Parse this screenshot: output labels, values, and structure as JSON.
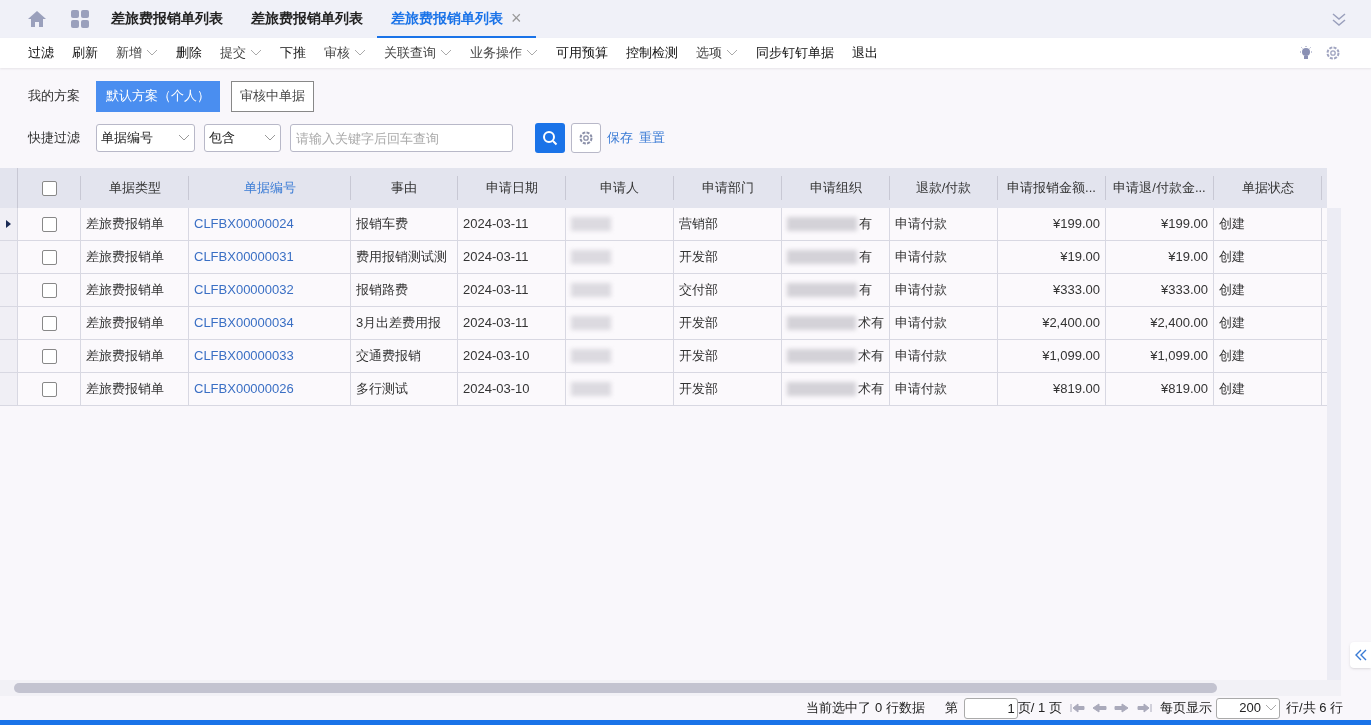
{
  "tabs": [
    {
      "label": "差旅费报销单列表",
      "selected": false,
      "closable": false
    },
    {
      "label": "差旅费报销单列表",
      "selected": false,
      "closable": false
    },
    {
      "label": "差旅费报销单列表",
      "selected": true,
      "closable": true
    }
  ],
  "close_glyph": "×",
  "toolbar": [
    {
      "label": "过滤",
      "dropdown": false
    },
    {
      "label": "刷新",
      "dropdown": false
    },
    {
      "label": "新增",
      "dropdown": true
    },
    {
      "label": "删除",
      "dropdown": false
    },
    {
      "label": "提交",
      "dropdown": true
    },
    {
      "label": "下推",
      "dropdown": false
    },
    {
      "label": "审核",
      "dropdown": true
    },
    {
      "label": "关联查询",
      "dropdown": true
    },
    {
      "label": "业务操作",
      "dropdown": true
    },
    {
      "label": "可用预算",
      "dropdown": false
    },
    {
      "label": "控制检测",
      "dropdown": false
    },
    {
      "label": "选项",
      "dropdown": true
    },
    {
      "label": "同步钉钉单据",
      "dropdown": false
    },
    {
      "label": "退出",
      "dropdown": false
    }
  ],
  "schemes": {
    "label": "我的方案",
    "items": [
      {
        "label": "默认方案（个人）",
        "selected": true
      },
      {
        "label": "审核中单据",
        "selected": false
      }
    ]
  },
  "quick_filter": {
    "label": "快捷过滤",
    "field": "单据编号",
    "operator": "包含",
    "placeholder": "请输入关键字后回车查询",
    "save": "保存",
    "reset": "重置"
  },
  "table": {
    "select_all_checked": false,
    "columns": [
      {
        "label": "单据类型",
        "sorted": false,
        "kind": "text"
      },
      {
        "label": "单据编号",
        "sorted": true,
        "kind": "link"
      },
      {
        "label": "事由",
        "sorted": false,
        "kind": "text"
      },
      {
        "label": "申请日期",
        "sorted": false,
        "kind": "text"
      },
      {
        "label": "申请人",
        "sorted": false,
        "kind": "blurred"
      },
      {
        "label": "申请部门",
        "sorted": false,
        "kind": "text"
      },
      {
        "label": "申请组织",
        "sorted": false,
        "kind": "partly_blurred"
      },
      {
        "label": "退款/付款",
        "sorted": false,
        "kind": "text"
      },
      {
        "label": "申请报销金额...",
        "sorted": false,
        "kind": "amount"
      },
      {
        "label": "申请退/付款金...",
        "sorted": false,
        "kind": "amount"
      },
      {
        "label": "单据状态",
        "sorted": false,
        "kind": "text"
      }
    ],
    "rows": [
      {
        "current": true,
        "checked": false,
        "cells": [
          "差旅费报销单",
          "CLFBX00000024",
          "报销车费",
          "2024-03-11",
          null,
          "营销部",
          "有",
          "申请付款",
          "¥199.00",
          "¥199.00",
          "创建"
        ]
      },
      {
        "current": false,
        "checked": false,
        "cells": [
          "差旅费报销单",
          "CLFBX00000031",
          "费用报销测试测",
          "2024-03-11",
          null,
          "开发部",
          "有",
          "申请付款",
          "¥19.00",
          "¥19.00",
          "创建"
        ]
      },
      {
        "current": false,
        "checked": false,
        "cells": [
          "差旅费报销单",
          "CLFBX00000032",
          "报销路费",
          "2024-03-11",
          null,
          "交付部",
          "有",
          "申请付款",
          "¥333.00",
          "¥333.00",
          "创建"
        ]
      },
      {
        "current": false,
        "checked": false,
        "cells": [
          "差旅费报销单",
          "CLFBX00000034",
          "3月出差费用报",
          "2024-03-11",
          null,
          "开发部",
          "术有",
          "申请付款",
          "¥2,400.00",
          "¥2,400.00",
          "创建"
        ]
      },
      {
        "current": false,
        "checked": false,
        "cells": [
          "差旅费报销单",
          "CLFBX00000033",
          "交通费报销",
          "2024-03-10",
          null,
          "开发部",
          "术有",
          "申请付款",
          "¥1,099.00",
          "¥1,099.00",
          "创建"
        ]
      },
      {
        "current": false,
        "checked": false,
        "cells": [
          "差旅费报销单",
          "CLFBX00000026",
          "多行测试",
          "2024-03-10",
          null,
          "开发部",
          "术有",
          "申请付款",
          "¥819.00",
          "¥819.00",
          "创建"
        ]
      }
    ]
  },
  "status_bar": {
    "selection": "当前选中了 0 行数据",
    "page_prefix": "第",
    "page": "1",
    "page_suffix": "页/ 1 页",
    "per_page_label": "每页显示",
    "per_page": "200",
    "total": "行/共 6 行"
  }
}
